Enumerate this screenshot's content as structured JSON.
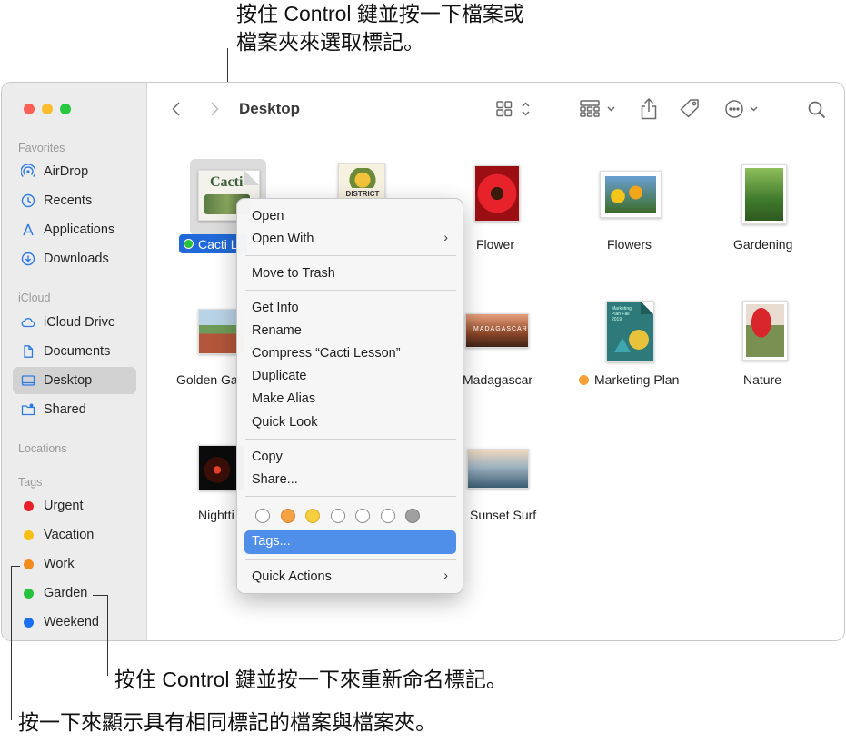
{
  "callouts": {
    "top_line1": "按住 Control 鍵並按一下檔案或",
    "top_line2": "檔案夾來選取標記。",
    "bottom_rename": "按住 Control 鍵並按一下來重新命名標記。",
    "bottom_show": "按一下來顯示具有相同標記的檔案與檔案夾。"
  },
  "toolbar": {
    "title": "Desktop",
    "icons": [
      "back-icon",
      "forward-icon",
      "grid-view-icon",
      "group-icon",
      "share-icon",
      "tag-icon",
      "more-icon",
      "search-icon"
    ]
  },
  "sidebar": {
    "favorites_label": "Favorites",
    "favorites": [
      {
        "label": "AirDrop",
        "icon": "airdrop-icon"
      },
      {
        "label": "Recents",
        "icon": "clock-icon"
      },
      {
        "label": "Applications",
        "icon": "applications-icon"
      },
      {
        "label": "Downloads",
        "icon": "download-icon"
      }
    ],
    "icloud_label": "iCloud",
    "icloud": [
      {
        "label": "iCloud Drive",
        "icon": "cloud-icon"
      },
      {
        "label": "Documents",
        "icon": "document-icon"
      },
      {
        "label": "Desktop",
        "icon": "desktop-icon",
        "selected": true
      },
      {
        "label": "Shared",
        "icon": "shared-folder-icon"
      }
    ],
    "locations_label": "Locations",
    "tags_label": "Tags",
    "tags": [
      {
        "label": "Urgent",
        "color": "#e8202a"
      },
      {
        "label": "Vacation",
        "color": "#f7bf11"
      },
      {
        "label": "Work",
        "color": "#f38a1c"
      },
      {
        "label": "Garden",
        "color": "#27c23c"
      },
      {
        "label": "Weekend",
        "color": "#1c6ff0"
      }
    ]
  },
  "files": [
    {
      "label": "Cacti L",
      "tag_color": "#27c23c",
      "selected": true
    },
    {
      "label": "",
      "note": ""
    },
    {
      "label": "Flower"
    },
    {
      "label": "Flowers"
    },
    {
      "label": "Gardening"
    },
    {
      "label": "Golden Ga"
    },
    {
      "label": "Madagascar"
    },
    {
      "label": "Marketing Plan",
      "tag_color": "#f3a23a"
    },
    {
      "label": "Nature"
    },
    {
      "label": "Nightti"
    },
    {
      "label": "Sunset Surf"
    }
  ],
  "thumb_text": {
    "cacti": "Cacti",
    "district": "DISTRICT",
    "marketing_title": "Marketing Plan Fall 2019",
    "madagascar": "MADAGASCAR"
  },
  "menu": {
    "open": "Open",
    "open_with": "Open With",
    "move_to_trash": "Move to Trash",
    "get_info": "Get Info",
    "rename": "Rename",
    "compress": "Compress “Cacti Lesson”",
    "duplicate": "Duplicate",
    "make_alias": "Make Alias",
    "quick_look": "Quick Look",
    "copy": "Copy",
    "share": "Share...",
    "tags": "Tags...",
    "quick_actions": "Quick Actions",
    "submenu_glyph": "›",
    "tag_colors": [
      "#ffffff",
      "#f5a243",
      "#f5cf3f",
      "#ffffff",
      "#ffffff",
      "#ffffff",
      "#a0a0a0"
    ]
  }
}
